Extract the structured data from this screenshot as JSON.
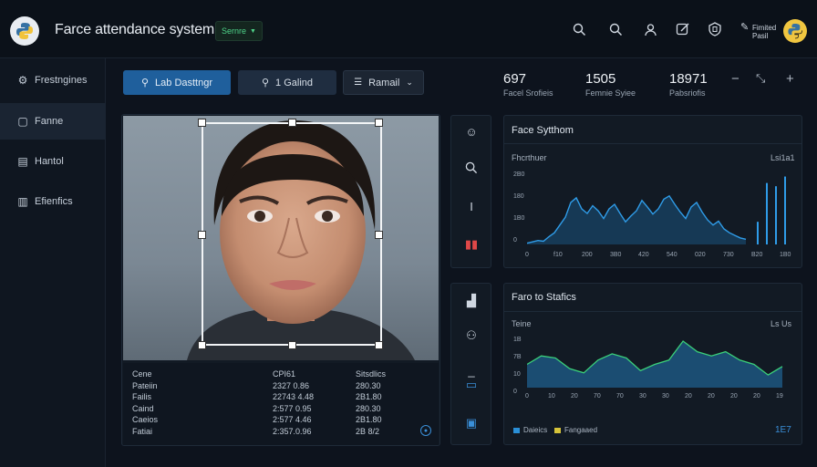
{
  "header": {
    "title": "Farce attendance system",
    "env_label": "Sernre",
    "notification_text_1": "Fimited",
    "notification_text_2": "Pasil"
  },
  "sidebar": {
    "items": [
      {
        "label": "Frestngines",
        "icon": "gear-icon"
      },
      {
        "label": "Fanne",
        "icon": "grid-icon"
      },
      {
        "label": "Hantol",
        "icon": "calendar-icon"
      },
      {
        "label": "Efienfics",
        "icon": "chart-icon"
      }
    ]
  },
  "toolbar": {
    "btn1": "Lab Dasttngr",
    "btn2": "1  Galind",
    "btn3": "Ramail"
  },
  "stats": [
    {
      "value": "697",
      "label": "Facel Srofieis"
    },
    {
      "value": "1505",
      "label": "Femnie Syiee"
    },
    {
      "value": "18971",
      "label": "Pabsriofis"
    }
  ],
  "face_table": {
    "col1": [
      "Cene",
      "Pateiin",
      "Failis",
      "Caind",
      "Caeios",
      "Fatiai"
    ],
    "col2": [
      "CPI61",
      "2327 0.86",
      "22743 4.48",
      "2:577 0.95",
      "2:577 4.46",
      "2:357.0.96"
    ],
    "col3": [
      "Sitsdlics",
      "280.30",
      "2B1.80",
      "280.30",
      "2B1.80",
      "2B 8/2"
    ]
  },
  "chart1": {
    "title": "Face Sytthom",
    "left_label": "Fhcrthuer",
    "right_label": "Lsi1a1",
    "y_ticks": [
      "2B0",
      "180",
      "1B0",
      "0"
    ],
    "x_ticks": [
      "0",
      "f10",
      "200",
      "3B0",
      "420",
      "540",
      "020",
      "730",
      "B20",
      "1B0"
    ],
    "values": [
      2,
      4,
      6,
      5,
      12,
      18,
      30,
      42,
      65,
      72,
      55,
      48,
      60,
      52,
      40,
      55,
      62,
      48,
      35,
      44,
      52,
      68,
      58,
      47,
      55,
      70,
      75,
      62,
      50,
      40,
      58,
      65,
      50,
      38,
      30,
      36,
      24,
      18,
      14,
      10,
      8
    ],
    "spikes": [
      35,
      95,
      90,
      105
    ]
  },
  "chart2": {
    "title": "Faro to Stafics",
    "left_label": "Teine",
    "right_label": "Ls Us",
    "y_ticks": [
      "1B",
      "7B",
      "10",
      "0"
    ],
    "x_ticks": [
      "0",
      "10",
      "20",
      "70",
      "70",
      "30",
      "30",
      "20",
      "20",
      "20",
      "20",
      "19"
    ],
    "values": [
      22,
      30,
      28,
      18,
      14,
      26,
      32,
      28,
      16,
      22,
      26,
      44,
      34,
      30,
      34,
      26,
      22,
      12,
      20
    ],
    "legend": [
      {
        "label": "Daieics",
        "color": "#2a8fd6"
      },
      {
        "label": "Fangaaed",
        "color": "#d6c43a"
      }
    ],
    "total": "1E7"
  },
  "colors": {
    "accent_blue": "#1f6fb5",
    "chart_line": "#2f9ce8",
    "chart2_line": "#3bd07a",
    "env_green": "#4fd48a"
  }
}
